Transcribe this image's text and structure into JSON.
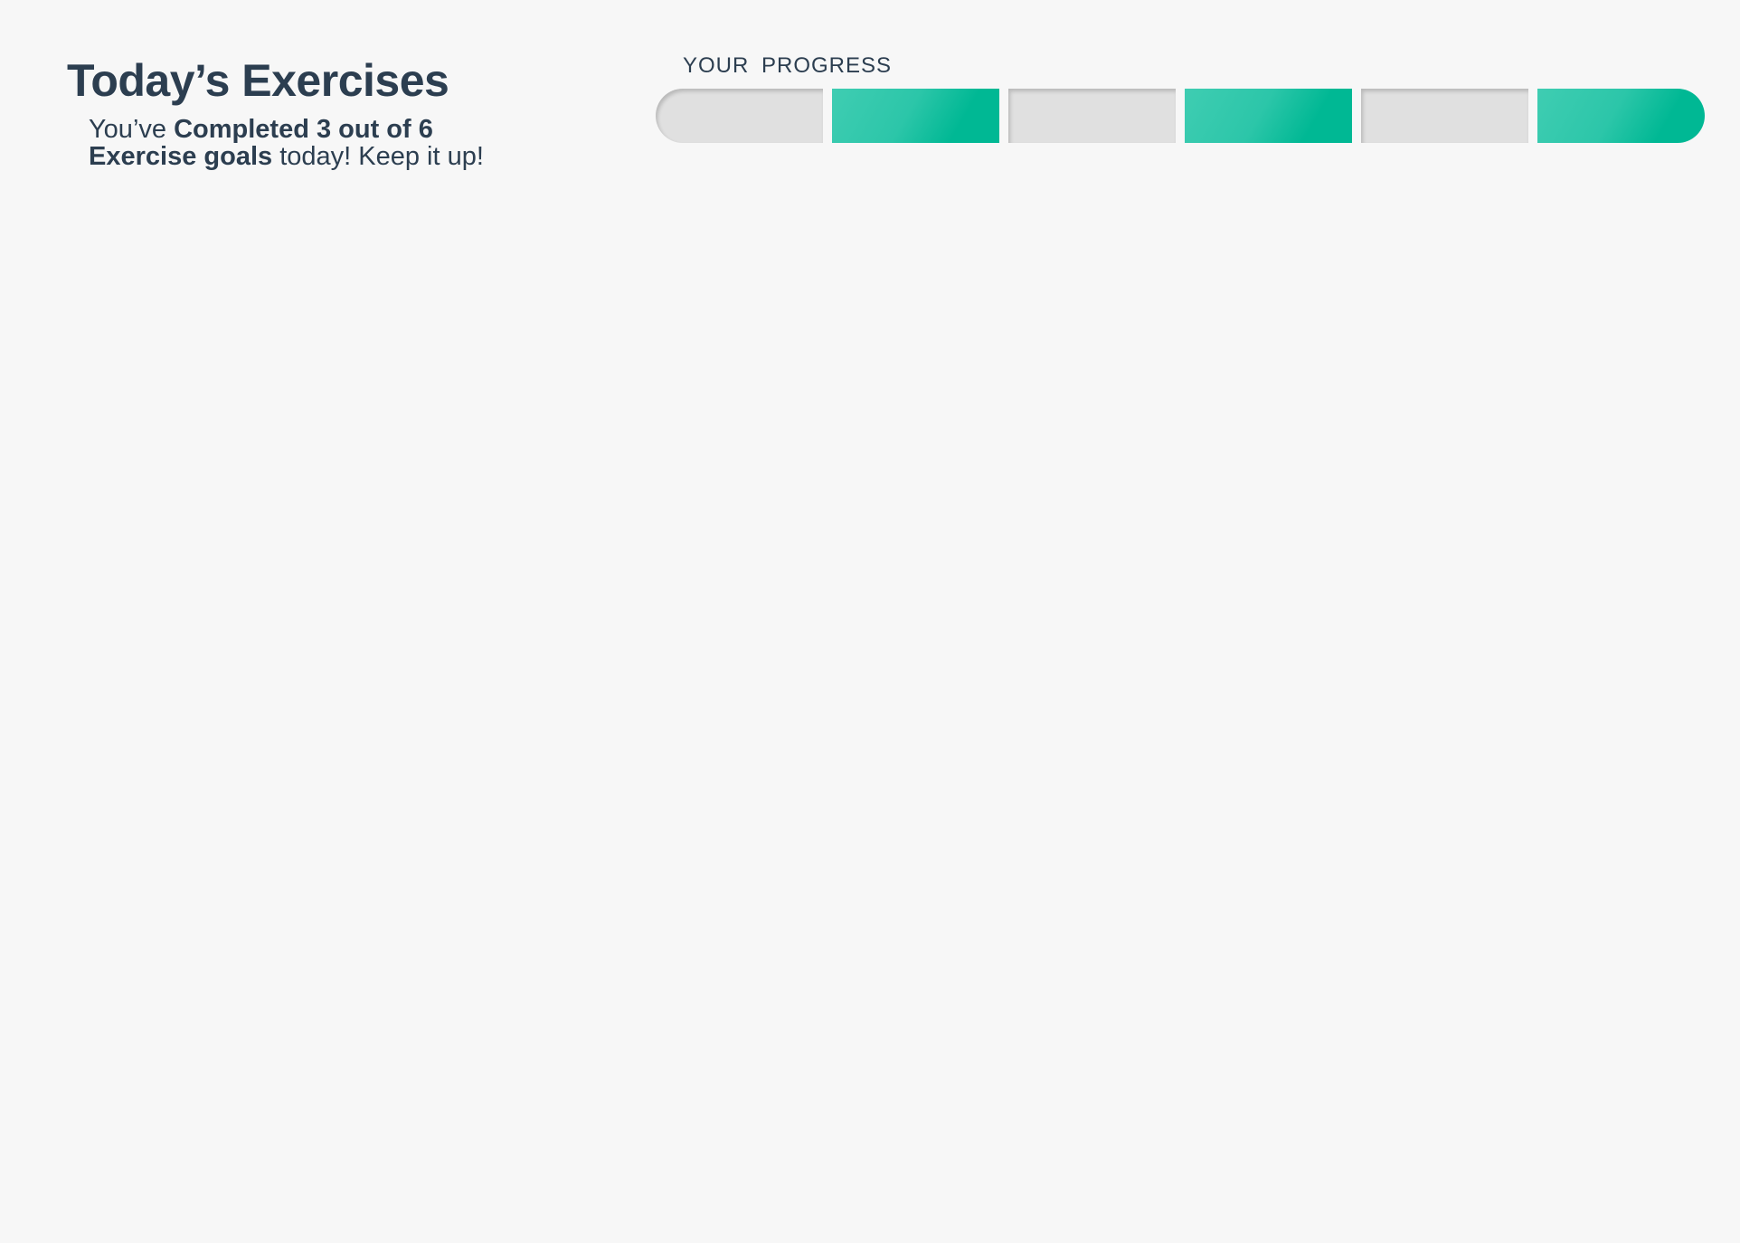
{
  "header": {
    "title": "Today’s Exercises",
    "summary": {
      "prefix": "You’ve ",
      "bold": "Completed 3 out of 6 Exercise goals",
      "suffix": " today! Keep it up!"
    }
  },
  "progress": {
    "label": "YOUR PROGRESS",
    "completed": 3,
    "total": 6,
    "segments": [
      {
        "status": "incomplete"
      },
      {
        "status": "complete"
      },
      {
        "status": "incomplete"
      },
      {
        "status": "complete"
      },
      {
        "status": "incomplete"
      },
      {
        "status": "complete"
      }
    ]
  },
  "colors": {
    "text": "#2c3e50",
    "complete": "#00b894",
    "incomplete": "#e0e0e0",
    "background": "#f7f7f7"
  }
}
